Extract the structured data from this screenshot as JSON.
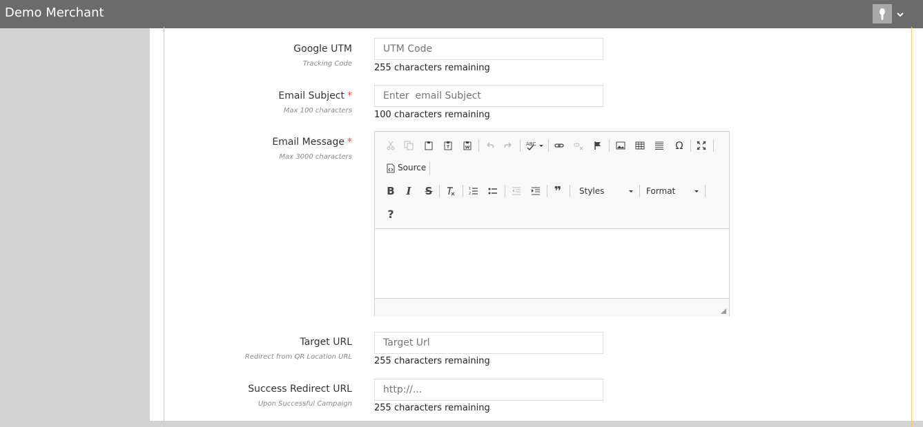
{
  "header": {
    "brand": "Demo Merchant",
    "avatar_icon": "user-silhouette-icon",
    "menu_icon": "chevron-down-icon"
  },
  "form": {
    "utm": {
      "label": "Google UTM",
      "help": "Tracking Code",
      "placeholder": "UTM Code",
      "remaining": "255 characters remaining"
    },
    "subject": {
      "label": "Email Subject",
      "required": "*",
      "help": "Max 100 characters",
      "placeholder": "Enter  email Subject",
      "remaining": "100 characters remaining"
    },
    "message": {
      "label": "Email Message",
      "required": "*",
      "help": "Max 3000 characters",
      "toolbar": {
        "source": "Source",
        "styles": "Styles",
        "format": "Format",
        "help": "?"
      }
    },
    "target": {
      "label": "Target URL",
      "help": "Redirect from QR Location URL",
      "placeholder": "Target Url",
      "remaining": "255 characters remaining"
    },
    "success": {
      "label": "Success Redirect URL",
      "help": "Upon Successful Campaign",
      "placeholder": "http://...",
      "remaining": "255 characters remaining"
    }
  },
  "colors": {
    "topbar": "#6b6b6b",
    "sidebar": "#d3d3d3",
    "panel_border": "#f5c96b",
    "required": "#d9534f"
  }
}
